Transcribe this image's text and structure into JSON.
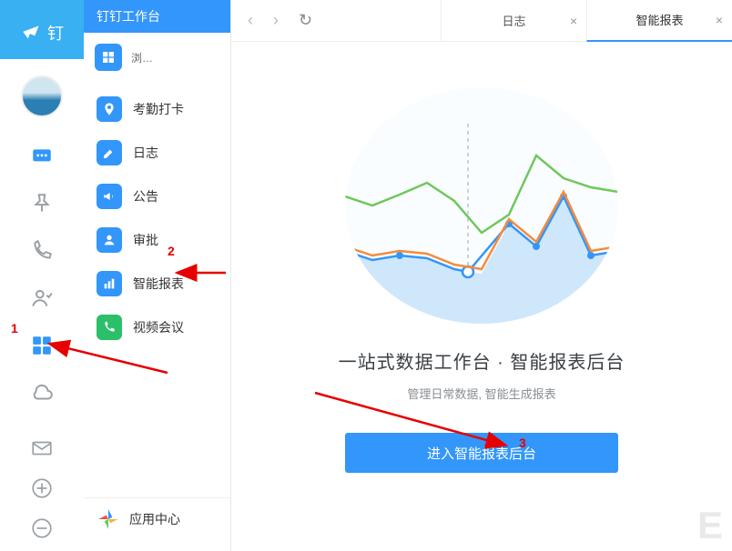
{
  "app_logo_text": "钉",
  "side_panel_title": "钉钉工作台",
  "side_top_label": "浏…",
  "menu": [
    {
      "label": "考勤打卡",
      "icon": "location"
    },
    {
      "label": "日志",
      "icon": "edit"
    },
    {
      "label": "公告",
      "icon": "megaphone"
    },
    {
      "label": "审批",
      "icon": "user-check"
    },
    {
      "label": "智能报表",
      "icon": "bar-chart"
    },
    {
      "label": "视频会议",
      "icon": "video-call"
    }
  ],
  "app_center_label": "应用中心",
  "tabs": [
    {
      "label": "日志",
      "active": false
    },
    {
      "label": "智能报表",
      "active": true
    }
  ],
  "content_heading": "一站式数据工作台 · 智能报表后台",
  "content_sub": "管理日常数据, 智能生成报表",
  "cta_label": "进入智能报表后台",
  "annotations": {
    "a1": "1",
    "a2": "2",
    "a3": "3"
  },
  "chart_data": {
    "type": "line",
    "title": "",
    "xlabel": "",
    "ylabel": "",
    "x": [
      0,
      1,
      2,
      3,
      4,
      5,
      6,
      7,
      8,
      9
    ],
    "series": [
      {
        "name": "green",
        "values": [
          60,
          55,
          62,
          70,
          58,
          40,
          50,
          82,
          70,
          66
        ],
        "color": "#6ec85a"
      },
      {
        "name": "orange",
        "values": [
          50,
          44,
          48,
          45,
          35,
          30,
          55,
          40,
          65,
          38
        ],
        "color": "#f58b3c"
      },
      {
        "name": "blue",
        "values": [
          48,
          42,
          45,
          42,
          32,
          28,
          52,
          38,
          62,
          34
        ],
        "color": "#3296fa",
        "fill": true
      }
    ],
    "highlight_x": 5,
    "ylim": [
      0,
      100
    ]
  }
}
